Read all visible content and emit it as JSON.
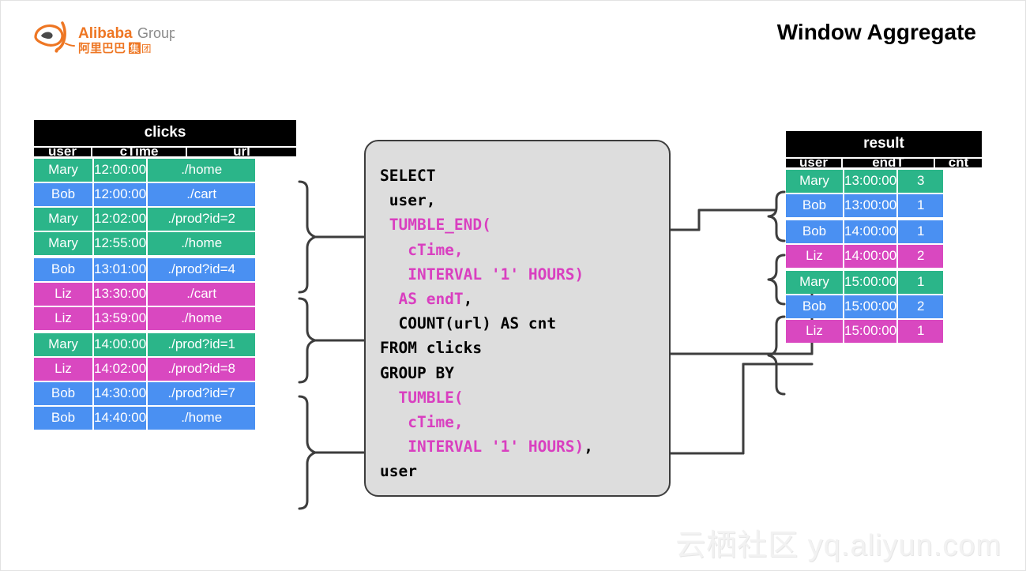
{
  "brand": {
    "logo_name": "alibaba-group-logo",
    "logo_text_en": "Alibaba",
    "logo_text_group": "Group",
    "logo_text_cn": "阿里巴巴集团",
    "logo_color": "#EE7623",
    "logo_gray": "#808080"
  },
  "header": {
    "title": "Window Aggregate"
  },
  "colors": {
    "green": "#2BB589",
    "blue": "#4A90F2",
    "pink": "#D948C0",
    "header_bg": "#000000",
    "sql_bg": "#dddddd",
    "sql_border": "#3d3d3d",
    "sql_keyword": "#D93FC0",
    "connector": "#3d3d3d"
  },
  "clicks": {
    "title": "clicks",
    "columns": [
      "user",
      "cTime",
      "url"
    ],
    "groups": [
      {
        "name": "window-12-13",
        "rows": [
          {
            "user": "Mary",
            "cTime": "12:00:00",
            "url": "./home",
            "color": "green"
          },
          {
            "user": "Bob",
            "cTime": "12:00:00",
            "url": "./cart",
            "color": "blue"
          },
          {
            "user": "Mary",
            "cTime": "12:02:00",
            "url": "./prod?id=2",
            "color": "green"
          },
          {
            "user": "Mary",
            "cTime": "12:55:00",
            "url": "./home",
            "color": "green"
          }
        ]
      },
      {
        "name": "window-13-14",
        "rows": [
          {
            "user": "Bob",
            "cTime": "13:01:00",
            "url": "./prod?id=4",
            "color": "blue"
          },
          {
            "user": "Liz",
            "cTime": "13:30:00",
            "url": "./cart",
            "color": "pink"
          },
          {
            "user": "Liz",
            "cTime": "13:59:00",
            "url": "./home",
            "color": "pink"
          }
        ]
      },
      {
        "name": "window-14-15",
        "rows": [
          {
            "user": "Mary",
            "cTime": "14:00:00",
            "url": "./prod?id=1",
            "color": "green"
          },
          {
            "user": "Liz",
            "cTime": "14:02:00",
            "url": "./prod?id=8",
            "color": "pink"
          },
          {
            "user": "Bob",
            "cTime": "14:30:00",
            "url": "./prod?id=7",
            "color": "blue"
          },
          {
            "user": "Bob",
            "cTime": "14:40:00",
            "url": "./home",
            "color": "blue"
          }
        ]
      }
    ]
  },
  "result": {
    "title": "result",
    "columns": [
      "user",
      "endT",
      "cnt"
    ],
    "groups": [
      {
        "name": "result-13",
        "rows": [
          {
            "user": "Mary",
            "endT": "13:00:00",
            "cnt": "3",
            "color": "green"
          },
          {
            "user": "Bob",
            "endT": "13:00:00",
            "cnt": "1",
            "color": "blue"
          }
        ]
      },
      {
        "name": "result-14",
        "rows": [
          {
            "user": "Bob",
            "endT": "14:00:00",
            "cnt": "1",
            "color": "blue"
          },
          {
            "user": "Liz",
            "endT": "14:00:00",
            "cnt": "2",
            "color": "pink"
          }
        ]
      },
      {
        "name": "result-15",
        "rows": [
          {
            "user": "Mary",
            "endT": "15:00:00",
            "cnt": "1",
            "color": "green"
          },
          {
            "user": "Bob",
            "endT": "15:00:00",
            "cnt": "2",
            "color": "blue"
          },
          {
            "user": "Liz",
            "endT": "15:00:00",
            "cnt": "1",
            "color": "pink"
          }
        ]
      }
    ]
  },
  "sql": {
    "lines": [
      [
        {
          "t": "SELECT",
          "c": "dark"
        }
      ],
      [
        {
          "t": " user,",
          "c": "dark"
        }
      ],
      [
        {
          "t": " TUMBLE_END(",
          "c": "pink"
        }
      ],
      [
        {
          "t": "   cTime,",
          "c": "pink"
        }
      ],
      [
        {
          "t": "   INTERVAL '1' HOURS)",
          "c": "pink"
        }
      ],
      [
        {
          "t": "  AS endT",
          "c": "pink"
        },
        {
          "t": ",",
          "c": "dark"
        }
      ],
      [
        {
          "t": "  COUNT(url) AS cnt",
          "c": "dark"
        }
      ],
      [
        {
          "t": "FROM clicks",
          "c": "dark"
        }
      ],
      [
        {
          "t": "GROUP BY",
          "c": "dark"
        }
      ],
      [
        {
          "t": "  TUMBLE(",
          "c": "pink"
        }
      ],
      [
        {
          "t": "   cTime,",
          "c": "pink"
        }
      ],
      [
        {
          "t": "   INTERVAL '1' HOURS)",
          "c": "pink"
        },
        {
          "t": ",",
          "c": "dark"
        }
      ],
      [
        {
          "t": "user",
          "c": "dark"
        }
      ]
    ]
  },
  "watermark": {
    "text": "云栖社区 yq.aliyun.com"
  }
}
